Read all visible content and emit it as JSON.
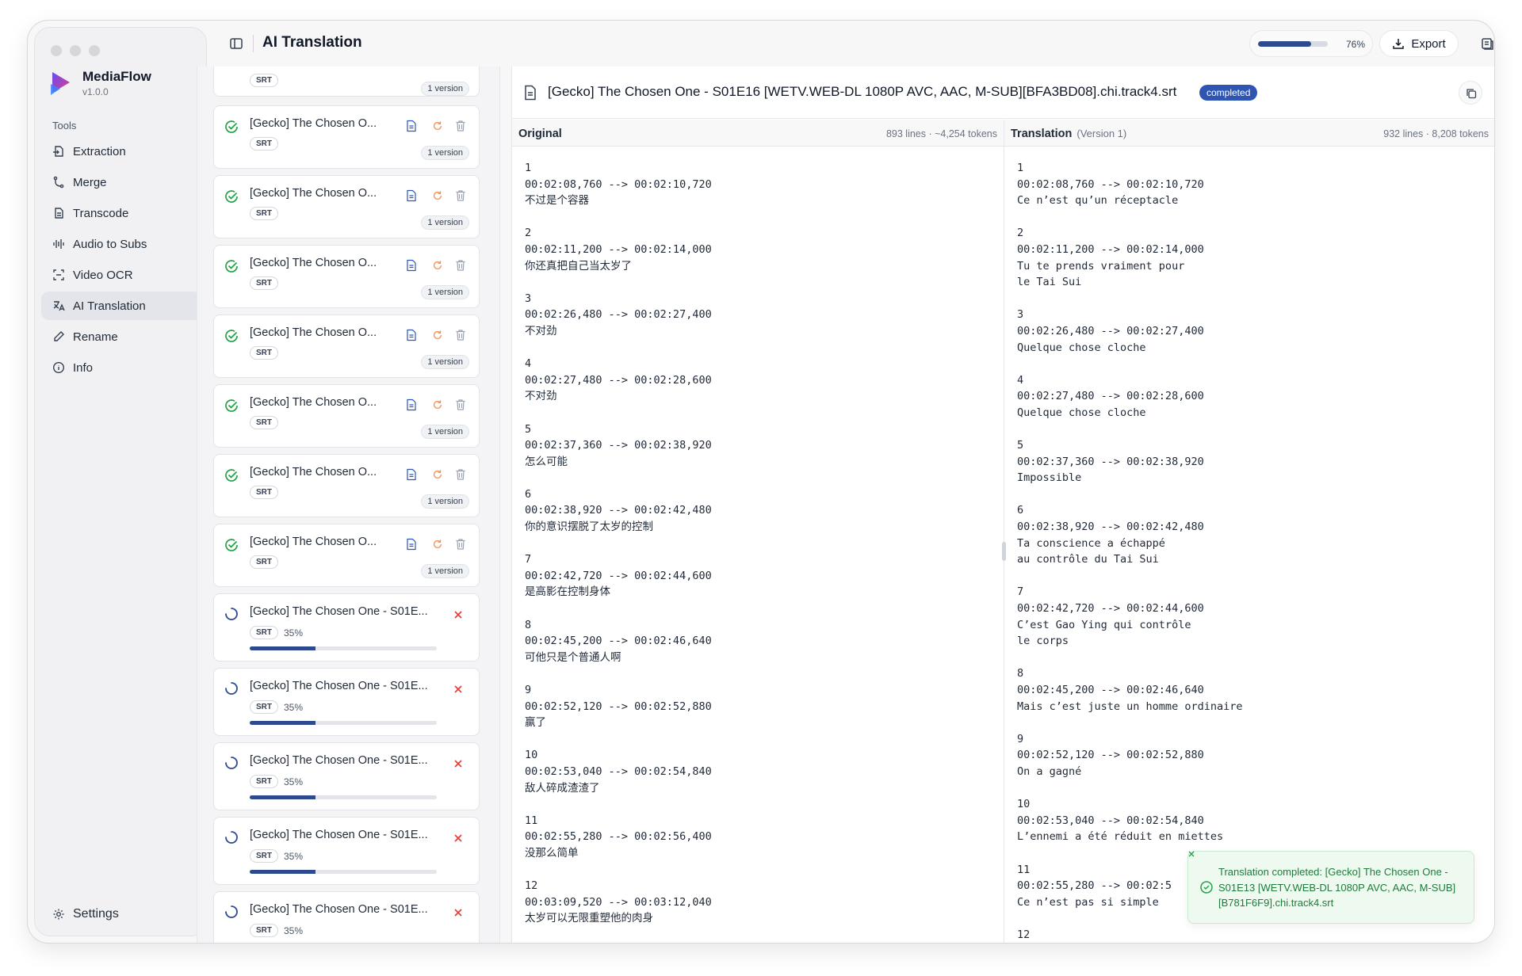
{
  "app": {
    "name": "MediaFlow",
    "version": "v1.0.0"
  },
  "sidebar": {
    "section_label": "Tools",
    "items": [
      {
        "label": "Extraction",
        "icon": "extraction-icon"
      },
      {
        "label": "Merge",
        "icon": "merge-icon"
      },
      {
        "label": "Transcode",
        "icon": "transcode-icon"
      },
      {
        "label": "Audio to Subs",
        "icon": "audio-wave-icon"
      },
      {
        "label": "Video OCR",
        "icon": "scan-icon"
      },
      {
        "label": "AI Translation",
        "icon": "translate-icon",
        "active": true
      },
      {
        "label": "Rename",
        "icon": "pencil-icon"
      },
      {
        "label": "Info",
        "icon": "info-icon"
      }
    ],
    "settings_label": "Settings"
  },
  "header": {
    "title": "AI Translation",
    "progress": {
      "value": 76,
      "label": "76%"
    },
    "export_label": "Export"
  },
  "files": {
    "completed": [
      {
        "name": "",
        "format": "SRT",
        "versions": "1 version"
      },
      {
        "name": "[Gecko] The Chosen O...",
        "format": "SRT",
        "versions": "1 version"
      },
      {
        "name": "[Gecko] The Chosen O...",
        "format": "SRT",
        "versions": "1 version"
      },
      {
        "name": "[Gecko] The Chosen O...",
        "format": "SRT",
        "versions": "1 version"
      },
      {
        "name": "[Gecko] The Chosen O...",
        "format": "SRT",
        "versions": "1 version"
      },
      {
        "name": "[Gecko] The Chosen O...",
        "format": "SRT",
        "versions": "1 version"
      },
      {
        "name": "[Gecko] The Chosen O...",
        "format": "SRT",
        "versions": "1 version"
      },
      {
        "name": "[Gecko] The Chosen O...",
        "format": "SRT",
        "versions": "1 version"
      }
    ],
    "in_progress": [
      {
        "name": "[Gecko] The Chosen One - S01E...",
        "format": "SRT",
        "percent_label": "35%",
        "progress": 0.35
      },
      {
        "name": "[Gecko] The Chosen One - S01E...",
        "format": "SRT",
        "percent_label": "35%",
        "progress": 0.35
      },
      {
        "name": "[Gecko] The Chosen One - S01E...",
        "format": "SRT",
        "percent_label": "35%",
        "progress": 0.35
      },
      {
        "name": "[Gecko] The Chosen One - S01E...",
        "format": "SRT",
        "percent_label": "35%",
        "progress": 0.35
      },
      {
        "name": "[Gecko] The Chosen One - S01E...",
        "format": "SRT",
        "percent_label": "35%",
        "progress": 0.35
      }
    ]
  },
  "viewer": {
    "file_name": "[Gecko] The Chosen One - S01E16 [WETV.WEB-DL 1080P AVC, AAC, M-SUB][BFA3BD08].chi.track4.srt",
    "status": "completed",
    "original": {
      "title": "Original",
      "stats": "893 lines · ~4,254 tokens",
      "entries": [
        [
          "1",
          "00:02:08,760 --> 00:02:10,720",
          "不过是个容器"
        ],
        [
          "2",
          "00:02:11,200 --> 00:02:14,000",
          "你还真把自己当太岁了"
        ],
        [
          "3",
          "00:02:26,480 --> 00:02:27,400",
          "不对劲"
        ],
        [
          "4",
          "00:02:27,480 --> 00:02:28,600",
          "不对劲"
        ],
        [
          "5",
          "00:02:37,360 --> 00:02:38,920",
          "怎么可能"
        ],
        [
          "6",
          "00:02:38,920 --> 00:02:42,480",
          "你的意识摆脱了太岁的控制"
        ],
        [
          "7",
          "00:02:42,720 --> 00:02:44,600",
          "是高影在控制身体"
        ],
        [
          "8",
          "00:02:45,200 --> 00:02:46,640",
          "可他只是个普通人啊"
        ],
        [
          "9",
          "00:02:52,120 --> 00:02:52,880",
          "赢了"
        ],
        [
          "10",
          "00:02:53,040 --> 00:02:54,840",
          "敌人碎成渣渣了"
        ],
        [
          "11",
          "00:02:55,280 --> 00:02:56,400",
          "没那么简单"
        ],
        [
          "12",
          "00:03:09,520 --> 00:03:12,040",
          "太岁可以无限重塑他的肉身"
        ]
      ]
    },
    "translation": {
      "title": "Translation",
      "version": "(Version 1)",
      "stats": "932 lines · 8,208 tokens",
      "entries": [
        [
          "1",
          "00:02:08,760 --> 00:02:10,720",
          "Ce n’est qu’un réceptacle"
        ],
        [
          "2",
          "00:02:11,200 --> 00:02:14,000",
          "Tu te prends vraiment pour",
          "le Tai Sui"
        ],
        [
          "3",
          "00:02:26,480 --> 00:02:27,400",
          "Quelque chose cloche"
        ],
        [
          "4",
          "00:02:27,480 --> 00:02:28,600",
          "Quelque chose cloche"
        ],
        [
          "5",
          "00:02:37,360 --> 00:02:38,920",
          "Impossible"
        ],
        [
          "6",
          "00:02:38,920 --> 00:02:42,480",
          "Ta conscience a échappé",
          "au contrôle du Tai Sui"
        ],
        [
          "7",
          "00:02:42,720 --> 00:02:44,600",
          "C’est Gao Ying qui contrôle",
          "le corps"
        ],
        [
          "8",
          "00:02:45,200 --> 00:02:46,640",
          "Mais c’est juste un homme ordinaire"
        ],
        [
          "9",
          "00:02:52,120 --> 00:02:52,880",
          "On a gagné"
        ],
        [
          "10",
          "00:02:53,040 --> 00:02:54,840",
          "L’ennemi a été réduit en miettes"
        ],
        [
          "11",
          "00:02:55,280 --> 00:02:5",
          "Ce n’est pas si simple"
        ],
        [
          "12"
        ]
      ]
    }
  },
  "toast": {
    "message": "Translation completed: [Gecko] The Chosen One - S01E13 [WETV.WEB-DL 1080P AVC, AAC, M-SUB][B781F6F9].chi.track4.srt"
  },
  "colors": {
    "accent": "#2f55b3",
    "progress": "#2e4a8f",
    "success": "#22a24a",
    "spinner": "#2e4a8f",
    "danger": "#e53935",
    "warn": "#f08a4b"
  }
}
